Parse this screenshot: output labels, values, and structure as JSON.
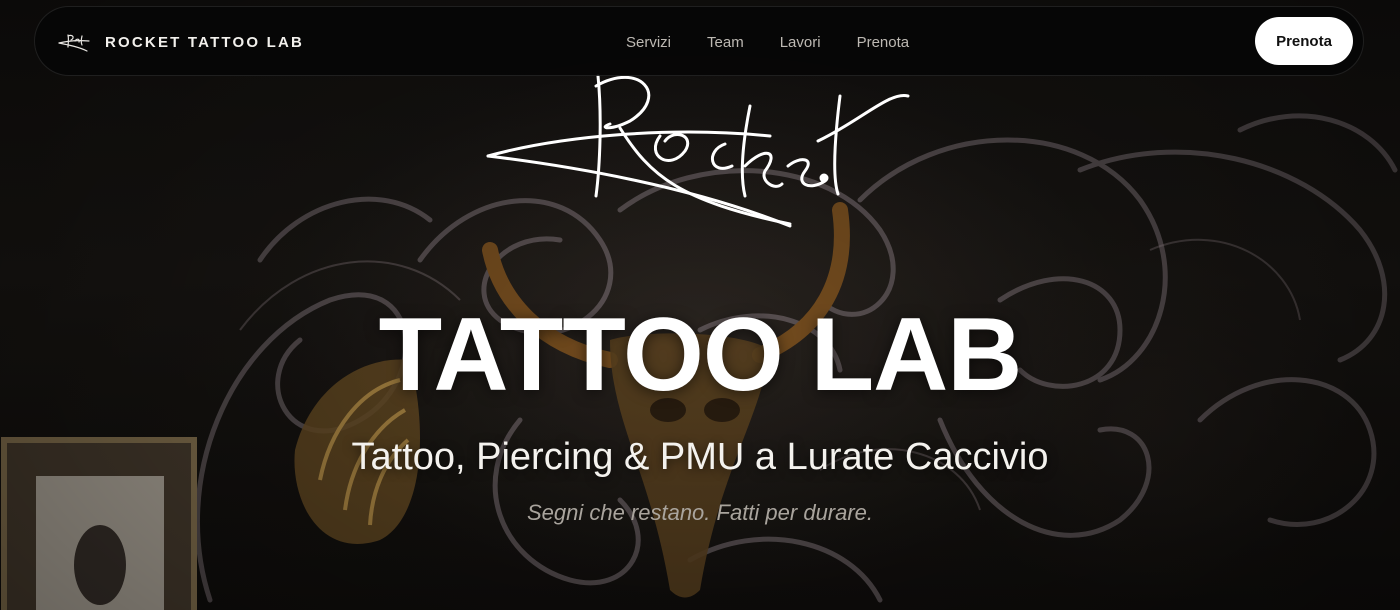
{
  "nav": {
    "brand": "ROCKET TATTOO LAB",
    "links": [
      "Servizi",
      "Team",
      "Lavori",
      "Prenota"
    ],
    "cta": "Prenota"
  },
  "hero": {
    "signature": "Rocket.",
    "title": "TATTOO LAB",
    "subtitle": "Tattoo, Piercing & PMU a Lurate Caccivio",
    "tagline": "Segni che restano. Fatti per durare."
  },
  "colors": {
    "background": "#141210",
    "text": "#ffffff",
    "nav_link": "#bdb9b3",
    "tagline": "#a9a49d",
    "cta_bg": "#ffffff",
    "cta_text": "#111111"
  }
}
